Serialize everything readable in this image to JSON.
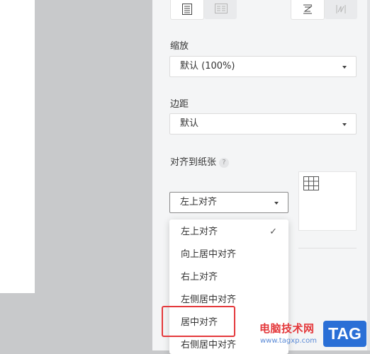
{
  "toolbar": {
    "buttons": [
      {
        "name": "layout-list-icon",
        "state": "selected"
      },
      {
        "name": "layout-grid-icon",
        "state": "normal"
      },
      {
        "name": "merge-cells-icon",
        "state": "normal"
      },
      {
        "name": "split-cells-icon",
        "state": "normal"
      }
    ]
  },
  "scale": {
    "label": "缩放",
    "value": "默认 (100%)"
  },
  "margin": {
    "label": "边距",
    "value": "默认"
  },
  "align": {
    "label": "对齐到纸张",
    "help": "?",
    "value": "左上对齐",
    "options": [
      {
        "label": "左上对齐",
        "checked": true
      },
      {
        "label": "向上居中对齐",
        "checked": false
      },
      {
        "label": "右上对齐",
        "checked": false
      },
      {
        "label": "左侧居中对齐",
        "checked": false
      },
      {
        "label": "居中对齐",
        "checked": false,
        "highlighted": true
      },
      {
        "label": "右侧居中对齐",
        "checked": false
      }
    ],
    "check_glyph": "✓"
  },
  "watermark": {
    "text": "电脑技术网",
    "url": "www.tagxp.com",
    "tag": "TAG"
  },
  "colors": {
    "panel_bg": "#f4f5f6",
    "workspace_bg": "#c8c9cb",
    "highlight": "#e4393c",
    "tag_blue": "#2a6fd6"
  }
}
